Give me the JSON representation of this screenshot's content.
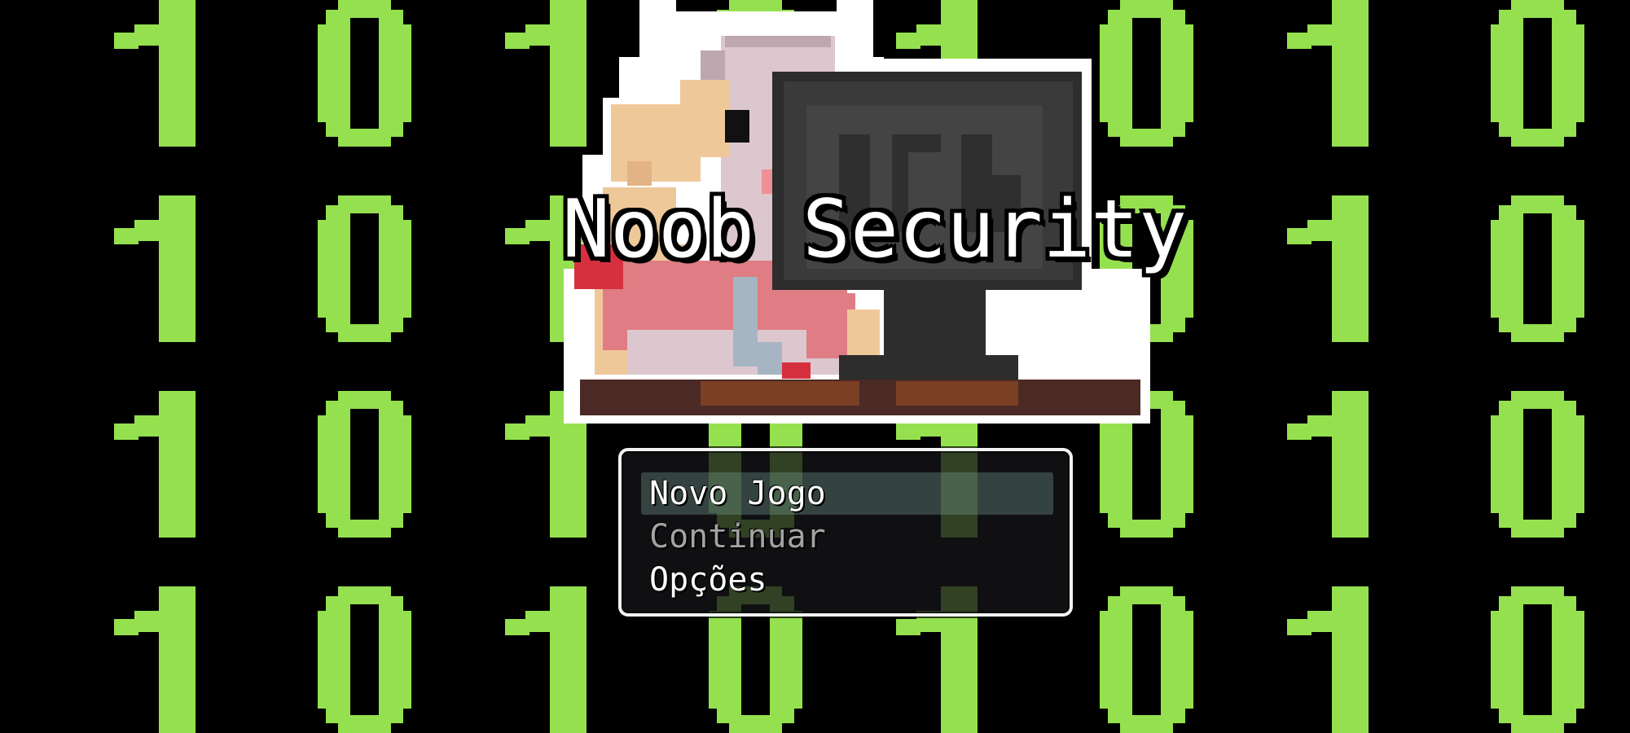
{
  "game": {
    "title": "Noob Security"
  },
  "menu": {
    "items": [
      {
        "label": "Novo Jogo",
        "state": "selected"
      },
      {
        "label": "Continuar",
        "state": "disabled"
      },
      {
        "label": "Opções",
        "state": "enabled"
      }
    ]
  },
  "background": {
    "digits": [
      [
        "1",
        "0",
        "1",
        "0",
        "1",
        "0",
        "1",
        "0"
      ],
      [
        "1",
        "0",
        "1",
        "0",
        "1",
        "0",
        "1",
        "0"
      ],
      [
        "1",
        "0",
        "1",
        "0",
        "1",
        "0",
        "1",
        "0"
      ],
      [
        "1",
        "0",
        "1",
        "0",
        "1",
        "0",
        "1",
        "0"
      ]
    ],
    "digit_color": "#95e04e",
    "background_color": "#000000"
  },
  "colors": {
    "menu_border": "#f2f2f2",
    "menu_text": "#ffffff",
    "menu_text_disabled": "#a3a3a3",
    "title_text": "#ffffff",
    "title_outline": "#000000"
  },
  "icons": {
    "logo": "hacker-at-computer-icon"
  }
}
